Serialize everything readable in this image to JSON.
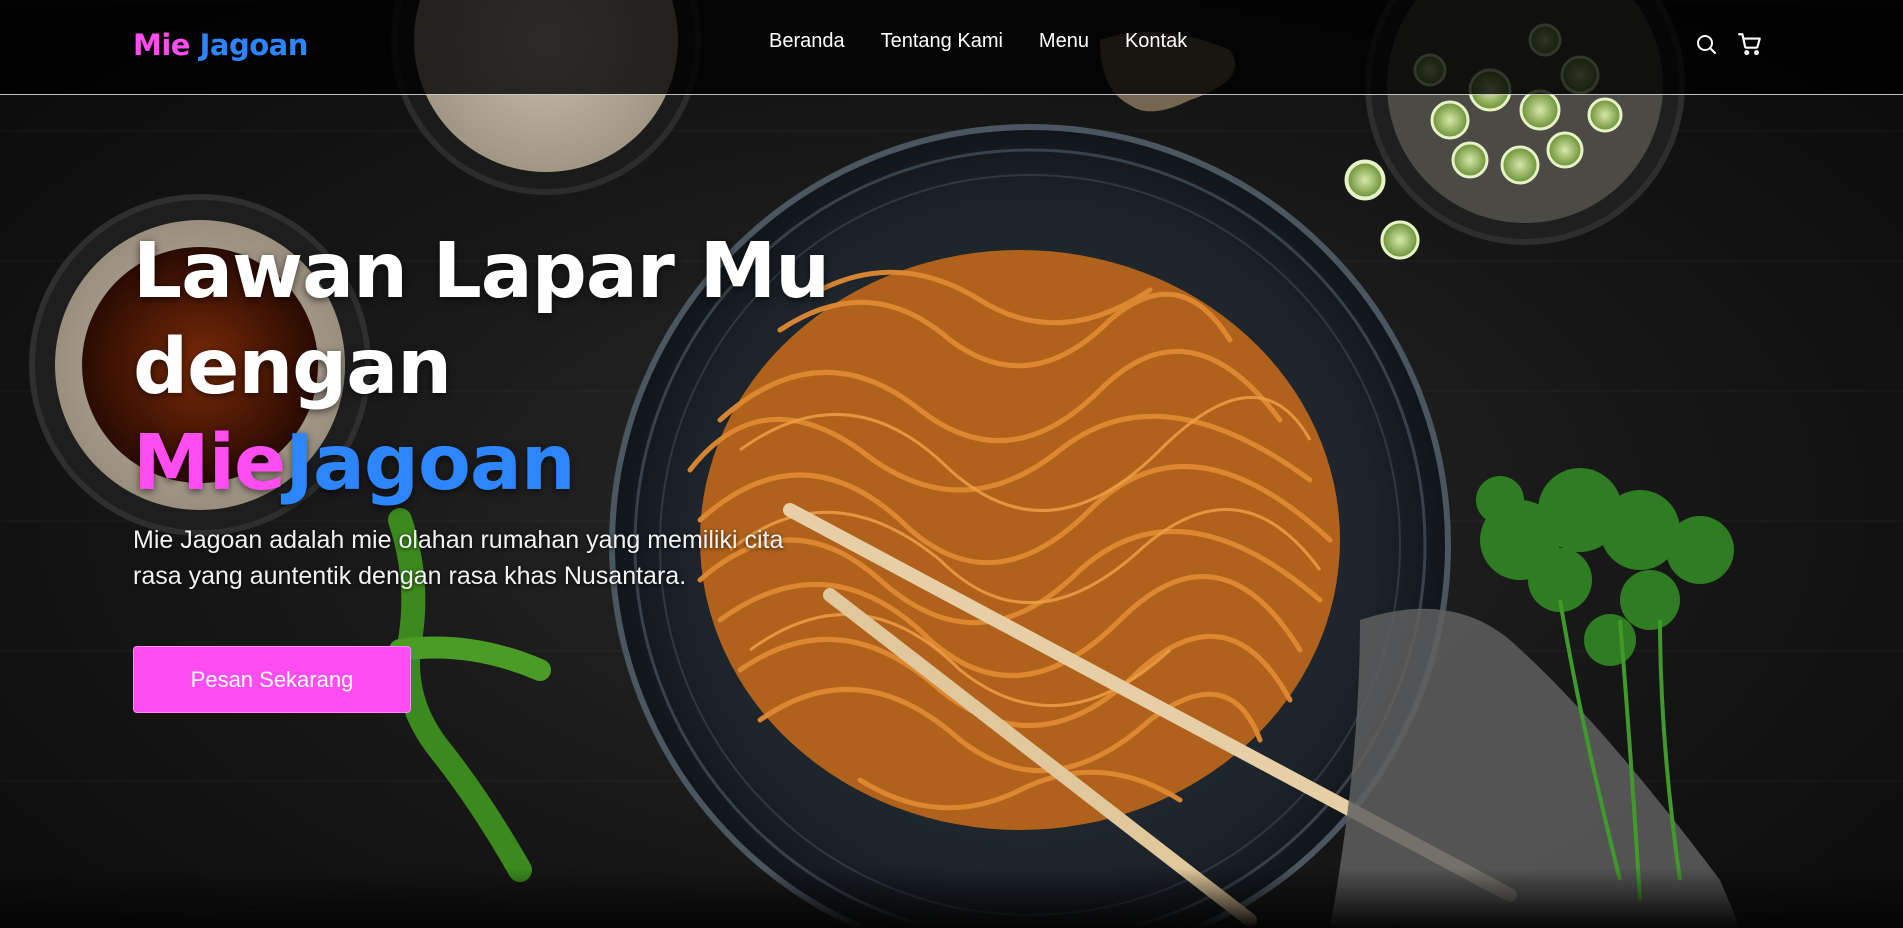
{
  "brand": {
    "part1": "Mie",
    "part2": "Jagoan"
  },
  "nav": {
    "links": [
      "Beranda",
      "Tentang Kami",
      "Menu",
      "Kontak"
    ],
    "icons": [
      "search-icon",
      "cart-icon"
    ]
  },
  "hero": {
    "headline_line1": "Lawan Lapar Mu",
    "headline_line2": "dengan",
    "headline_pink": "Mie",
    "headline_blue": "Jagoan",
    "subtitle": "Mie Jagoan adalah mie olahan rumahan yang memiliki cita rasa yang auntentik dengan rasa khas Nusantara.",
    "cta_label": "Pesan Sekarang"
  },
  "colors": {
    "pink": "#ff4df2",
    "blue": "#2e86ff",
    "navbar_bg": "#000000"
  }
}
